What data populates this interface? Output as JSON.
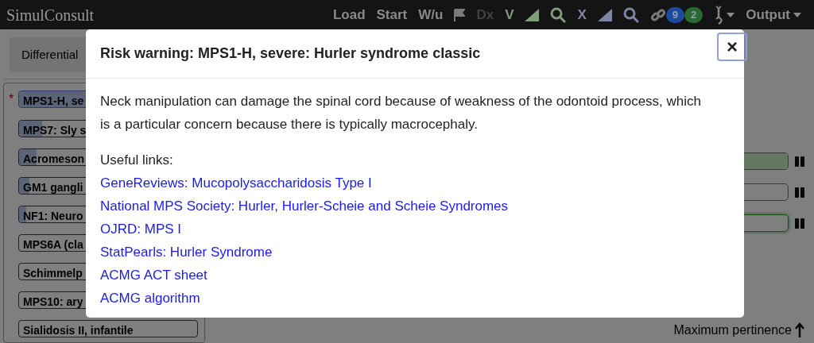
{
  "navbar": {
    "logo": "SimulConsult",
    "links": [
      {
        "label": "Load",
        "disabled": false
      },
      {
        "label": "Start",
        "disabled": false
      },
      {
        "label": "W/u",
        "disabled": false
      }
    ],
    "dx": {
      "label": "Dx",
      "disabled": true
    },
    "verify": {
      "label": "V",
      "color": "#7f9e78"
    },
    "exclude": {
      "label": "X",
      "color": "#7d86a8"
    },
    "badges": [
      {
        "count": "9",
        "color": "#1d4a9e"
      },
      {
        "count": "2",
        "color": "#2a6a30"
      }
    ],
    "output": "Output"
  },
  "tab": {
    "label": "Differential"
  },
  "star": "*",
  "diagnoses": [
    {
      "label": "MPS1-H, se",
      "starred": true,
      "selected": true,
      "level": 1
    },
    {
      "label": "MPS7: Sly s",
      "starred": false,
      "selected": false,
      "level": 0.13
    },
    {
      "label": "Acromeson",
      "starred": false,
      "selected": false,
      "level": 0.1
    },
    {
      "label": "GM1 gangli",
      "starred": false,
      "selected": false,
      "level": 0.06
    },
    {
      "label": "NF1: Neuro",
      "starred": false,
      "selected": false,
      "level": 0.04
    },
    {
      "label": "MPS6A (cla",
      "starred": false,
      "selected": false
    },
    {
      "label": "Schimmelp",
      "starred": false,
      "selected": false
    },
    {
      "label": "MPS10: ary",
      "starred": false,
      "selected": false
    },
    {
      "label": "Sialidosis II, infantile",
      "starred": false,
      "selected": false
    }
  ],
  "findings": [
    {
      "level": 1,
      "focused": false
    },
    {
      "level": 0,
      "focused": false
    },
    {
      "level": 0,
      "focused": true
    }
  ],
  "sort_label": "Maximum pertinence",
  "modal": {
    "title": "Risk warning: MPS1-H, severe: Hurler syndrome classic",
    "close": "×",
    "body": "Neck manipulation can damage the spinal cord because of weakness of the odontoid process, which is a particular concern because there is typically macrocephaly.",
    "links_heading": "Useful links:",
    "links": [
      "GeneReviews: Mucopolysaccharidosis Type I",
      "National MPS Society: Hurler, Hurler-Scheie and Scheie Syndromes",
      "OJRD: MPS I",
      "StatPearls: Hurler Syndrome",
      "ACMG ACT sheet",
      "ACMG algorithm"
    ]
  }
}
